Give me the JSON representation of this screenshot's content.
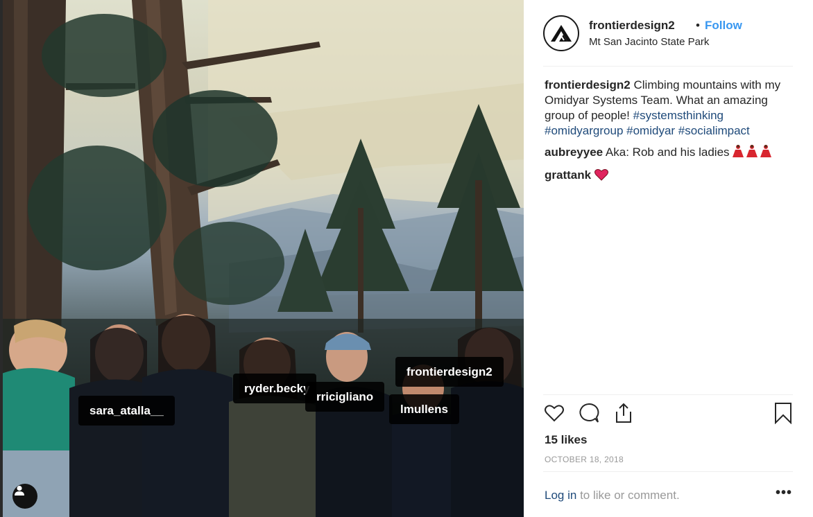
{
  "photo": {
    "tags": [
      {
        "id": "sara",
        "label": "sara_atalla__"
      },
      {
        "id": "ryder",
        "label": "ryder.becky"
      },
      {
        "id": "rric",
        "label": "rricigliano"
      },
      {
        "id": "front",
        "label": "frontierdesign2"
      },
      {
        "id": "lmul",
        "label": "lmullens"
      }
    ],
    "user_tag_icon": "person-icon"
  },
  "header": {
    "username": "frontierdesign2",
    "separator": "•",
    "follow_label": "Follow",
    "location": "Mt San Jacinto State Park",
    "avatar_icon": "frontier-logo-icon"
  },
  "comments": [
    {
      "user": "frontierdesign2",
      "text": "Climbing mountains with my Omidyar Systems Team. What an amazing group of people!",
      "hashtags": [
        "#systemsthinking",
        "#omidyargroup",
        "#omidyar",
        "#socialimpact"
      ]
    },
    {
      "user": "aubreyyee",
      "text": "Aka: Rob and his ladies",
      "emoji": "dancer-emoji"
    },
    {
      "user": "grattank",
      "text": "",
      "emoji": "red-heart-emoji"
    }
  ],
  "actions": {
    "like_icon": "heart-icon",
    "comment_icon": "comment-icon",
    "share_icon": "share-icon",
    "save_icon": "bookmark-icon"
  },
  "likes": "15 likes",
  "date": "OCTOBER 18, 2018",
  "footer": {
    "login_link": "Log in",
    "login_text": "to like or comment.",
    "more_label": "•••"
  },
  "colors": {
    "link_blue": "#3897f0",
    "hashtag": "#1f4a7a",
    "muted": "#999999",
    "heart": "#e0245e"
  }
}
